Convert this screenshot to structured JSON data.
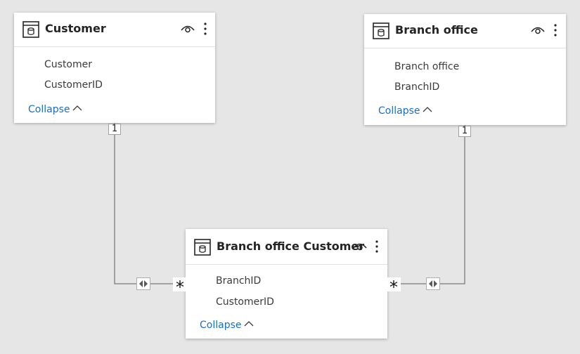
{
  "tables": [
    {
      "title": "Customer",
      "fields": [
        "Customer",
        "CustomerID"
      ],
      "collapse_label": "Collapse",
      "icon": "table-icon"
    },
    {
      "title": "Branch office",
      "fields": [
        "Branch office",
        "BranchID"
      ],
      "collapse_label": "Collapse",
      "icon": "table-icon"
    },
    {
      "title": "Branch office Customer",
      "fields": [
        "BranchID",
        "CustomerID"
      ],
      "collapse_label": "Collapse",
      "icon": "table-icon"
    }
  ],
  "relationships": [
    {
      "from": "Customer",
      "to": "Branch office Customer",
      "one_side_label": "1",
      "many_side_label": "*",
      "cross_filter": "both"
    },
    {
      "from": "Branch office",
      "to": "Branch office Customer",
      "one_side_label": "1",
      "many_side_label": "*",
      "cross_filter": "both"
    }
  ],
  "colors": {
    "canvas": "#e6e6e6",
    "card": "#ffffff",
    "link": "#1a6fc4",
    "line": "#7a7a7a"
  }
}
